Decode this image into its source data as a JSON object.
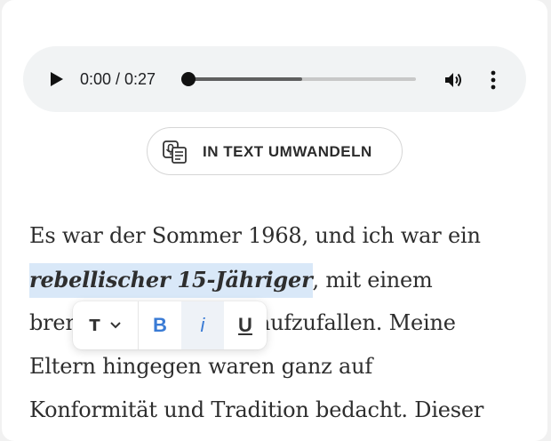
{
  "audio": {
    "time_display": "0:00 / 0:27",
    "progress": 0.0,
    "buffered": 0.5,
    "play_icon": "play-icon",
    "volume_icon": "volume-icon",
    "menu_icon": "more-vert-icon"
  },
  "convert": {
    "label": "IN TEXT UMWANDELN",
    "icon": "speech-to-text-icon"
  },
  "text": {
    "line1": "Es war der Sommer 1968, und ich war ein",
    "line2_highlight": "rebellischer 15-Jähriger",
    "line2_rest": ", mit einem",
    "line3_start": "bren",
    "line3_end": "t, aufzufallen. Meine",
    "line4": "Eltern hingegen waren ganz auf",
    "line5": "Konformität und Tradition bedacht. Dieser"
  },
  "toolbar": {
    "type_label": "T",
    "bold_label": "B",
    "italic_label": "i",
    "underline_label": "U"
  },
  "colors": {
    "highlight": "#d9e8f8",
    "accent": "#3a7bd5",
    "player_bg": "#f1f3f4"
  }
}
